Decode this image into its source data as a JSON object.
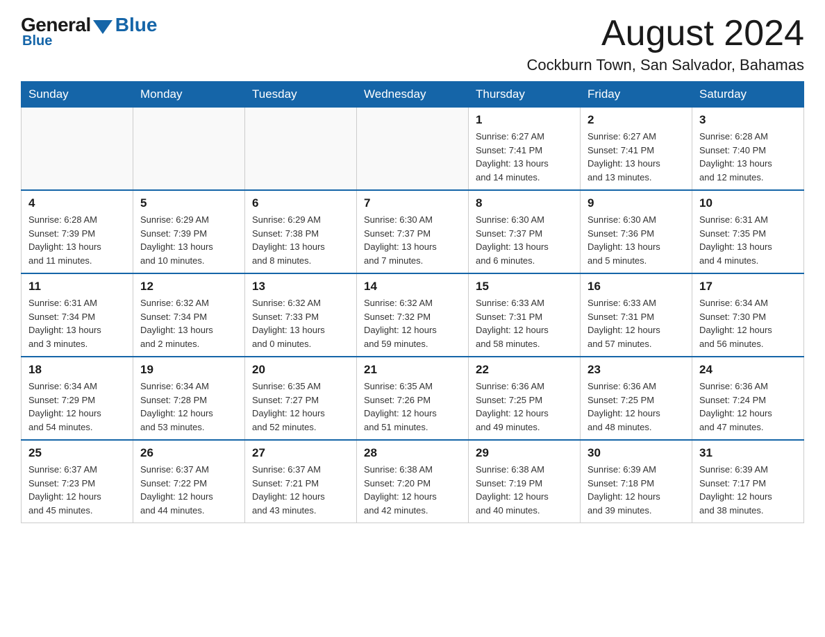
{
  "logo": {
    "general": "General",
    "blue": "Blue",
    "triangle": true
  },
  "header": {
    "month_title": "August 2024",
    "location": "Cockburn Town, San Salvador, Bahamas"
  },
  "days_of_week": [
    "Sunday",
    "Monday",
    "Tuesday",
    "Wednesday",
    "Thursday",
    "Friday",
    "Saturday"
  ],
  "weeks": [
    [
      {
        "day": "",
        "info": ""
      },
      {
        "day": "",
        "info": ""
      },
      {
        "day": "",
        "info": ""
      },
      {
        "day": "",
        "info": ""
      },
      {
        "day": "1",
        "info": "Sunrise: 6:27 AM\nSunset: 7:41 PM\nDaylight: 13 hours\nand 14 minutes."
      },
      {
        "day": "2",
        "info": "Sunrise: 6:27 AM\nSunset: 7:41 PM\nDaylight: 13 hours\nand 13 minutes."
      },
      {
        "day": "3",
        "info": "Sunrise: 6:28 AM\nSunset: 7:40 PM\nDaylight: 13 hours\nand 12 minutes."
      }
    ],
    [
      {
        "day": "4",
        "info": "Sunrise: 6:28 AM\nSunset: 7:39 PM\nDaylight: 13 hours\nand 11 minutes."
      },
      {
        "day": "5",
        "info": "Sunrise: 6:29 AM\nSunset: 7:39 PM\nDaylight: 13 hours\nand 10 minutes."
      },
      {
        "day": "6",
        "info": "Sunrise: 6:29 AM\nSunset: 7:38 PM\nDaylight: 13 hours\nand 8 minutes."
      },
      {
        "day": "7",
        "info": "Sunrise: 6:30 AM\nSunset: 7:37 PM\nDaylight: 13 hours\nand 7 minutes."
      },
      {
        "day": "8",
        "info": "Sunrise: 6:30 AM\nSunset: 7:37 PM\nDaylight: 13 hours\nand 6 minutes."
      },
      {
        "day": "9",
        "info": "Sunrise: 6:30 AM\nSunset: 7:36 PM\nDaylight: 13 hours\nand 5 minutes."
      },
      {
        "day": "10",
        "info": "Sunrise: 6:31 AM\nSunset: 7:35 PM\nDaylight: 13 hours\nand 4 minutes."
      }
    ],
    [
      {
        "day": "11",
        "info": "Sunrise: 6:31 AM\nSunset: 7:34 PM\nDaylight: 13 hours\nand 3 minutes."
      },
      {
        "day": "12",
        "info": "Sunrise: 6:32 AM\nSunset: 7:34 PM\nDaylight: 13 hours\nand 2 minutes."
      },
      {
        "day": "13",
        "info": "Sunrise: 6:32 AM\nSunset: 7:33 PM\nDaylight: 13 hours\nand 0 minutes."
      },
      {
        "day": "14",
        "info": "Sunrise: 6:32 AM\nSunset: 7:32 PM\nDaylight: 12 hours\nand 59 minutes."
      },
      {
        "day": "15",
        "info": "Sunrise: 6:33 AM\nSunset: 7:31 PM\nDaylight: 12 hours\nand 58 minutes."
      },
      {
        "day": "16",
        "info": "Sunrise: 6:33 AM\nSunset: 7:31 PM\nDaylight: 12 hours\nand 57 minutes."
      },
      {
        "day": "17",
        "info": "Sunrise: 6:34 AM\nSunset: 7:30 PM\nDaylight: 12 hours\nand 56 minutes."
      }
    ],
    [
      {
        "day": "18",
        "info": "Sunrise: 6:34 AM\nSunset: 7:29 PM\nDaylight: 12 hours\nand 54 minutes."
      },
      {
        "day": "19",
        "info": "Sunrise: 6:34 AM\nSunset: 7:28 PM\nDaylight: 12 hours\nand 53 minutes."
      },
      {
        "day": "20",
        "info": "Sunrise: 6:35 AM\nSunset: 7:27 PM\nDaylight: 12 hours\nand 52 minutes."
      },
      {
        "day": "21",
        "info": "Sunrise: 6:35 AM\nSunset: 7:26 PM\nDaylight: 12 hours\nand 51 minutes."
      },
      {
        "day": "22",
        "info": "Sunrise: 6:36 AM\nSunset: 7:25 PM\nDaylight: 12 hours\nand 49 minutes."
      },
      {
        "day": "23",
        "info": "Sunrise: 6:36 AM\nSunset: 7:25 PM\nDaylight: 12 hours\nand 48 minutes."
      },
      {
        "day": "24",
        "info": "Sunrise: 6:36 AM\nSunset: 7:24 PM\nDaylight: 12 hours\nand 47 minutes."
      }
    ],
    [
      {
        "day": "25",
        "info": "Sunrise: 6:37 AM\nSunset: 7:23 PM\nDaylight: 12 hours\nand 45 minutes."
      },
      {
        "day": "26",
        "info": "Sunrise: 6:37 AM\nSunset: 7:22 PM\nDaylight: 12 hours\nand 44 minutes."
      },
      {
        "day": "27",
        "info": "Sunrise: 6:37 AM\nSunset: 7:21 PM\nDaylight: 12 hours\nand 43 minutes."
      },
      {
        "day": "28",
        "info": "Sunrise: 6:38 AM\nSunset: 7:20 PM\nDaylight: 12 hours\nand 42 minutes."
      },
      {
        "day": "29",
        "info": "Sunrise: 6:38 AM\nSunset: 7:19 PM\nDaylight: 12 hours\nand 40 minutes."
      },
      {
        "day": "30",
        "info": "Sunrise: 6:39 AM\nSunset: 7:18 PM\nDaylight: 12 hours\nand 39 minutes."
      },
      {
        "day": "31",
        "info": "Sunrise: 6:39 AM\nSunset: 7:17 PM\nDaylight: 12 hours\nand 38 minutes."
      }
    ]
  ]
}
